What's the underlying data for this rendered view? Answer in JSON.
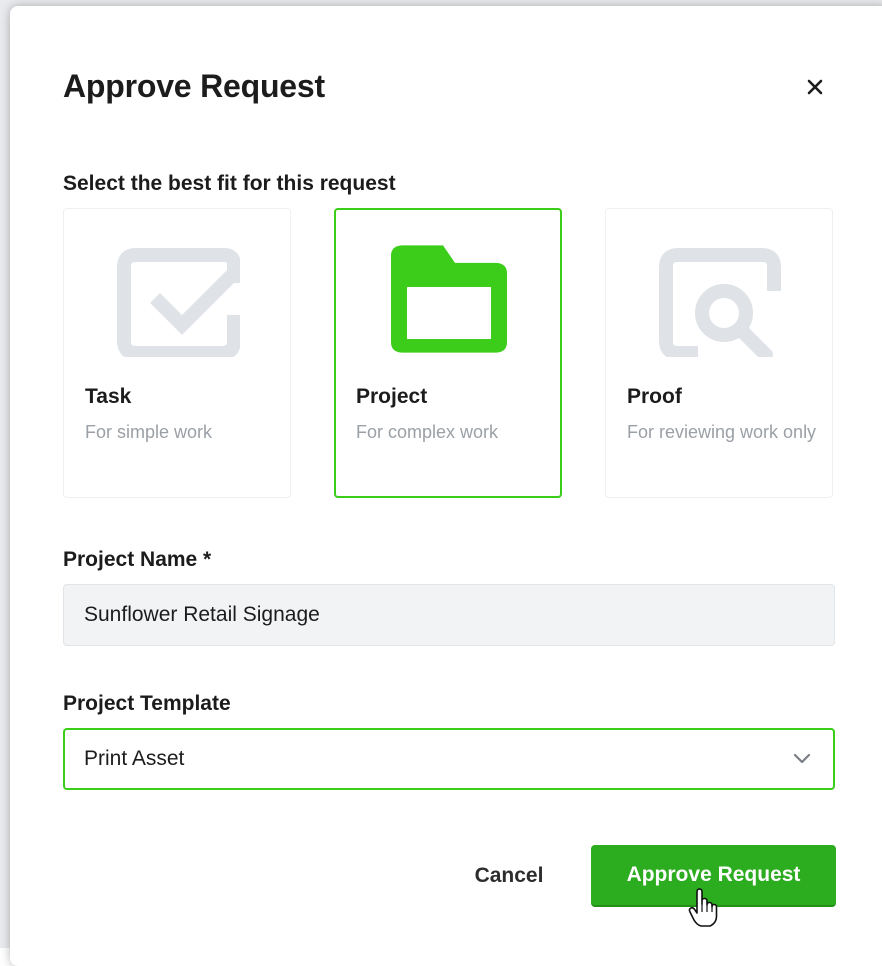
{
  "dialog": {
    "title": "Approve Request",
    "close_icon": "close-icon"
  },
  "type_selection": {
    "label": "Select the best fit for this request",
    "options": [
      {
        "title": "Task",
        "description": "For simple work",
        "icon": "checkbox-icon",
        "selected": false
      },
      {
        "title": "Project",
        "description": "For complex work",
        "icon": "folder-icon",
        "selected": true
      },
      {
        "title": "Proof",
        "description": "For reviewing work only",
        "icon": "proof-magnifier-icon",
        "selected": false
      }
    ]
  },
  "project_name": {
    "label": "Project Name *",
    "value": "Sunflower Retail Signage"
  },
  "project_template": {
    "label": "Project Template",
    "selected": "Print Asset",
    "icon": "chevron-down-icon"
  },
  "actions": {
    "cancel_label": "Cancel",
    "approve_label": "Approve Request"
  },
  "colors": {
    "accent_green": "#3ccd1b",
    "button_green": "#2cac1f",
    "icon_gray": "#dfe2e6",
    "muted_text": "#9aa0a6"
  }
}
